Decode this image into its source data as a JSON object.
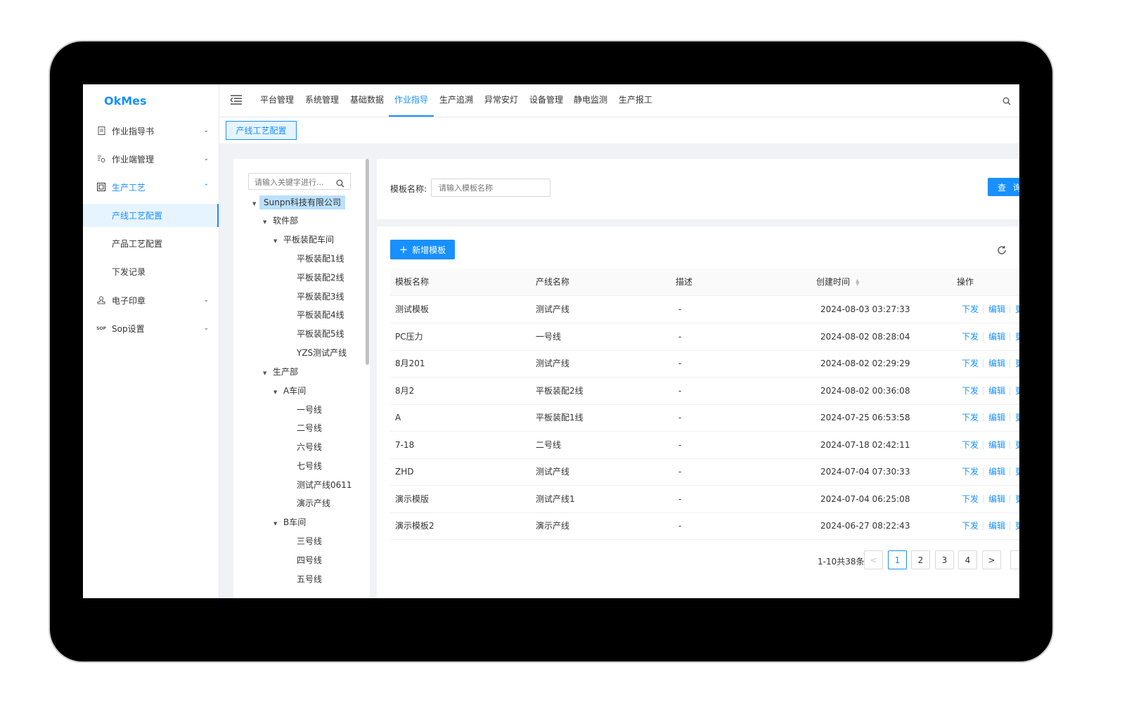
{
  "app": {
    "logo": "OkMes"
  },
  "sidebar": {
    "items": [
      {
        "label": "作业指导书",
        "icon": "document-icon"
      },
      {
        "label": "作业端管理",
        "icon": "terminal-icon"
      },
      {
        "label": "生产工艺",
        "icon": "process-icon"
      },
      {
        "label": "电子印章",
        "icon": "stamp-icon"
      },
      {
        "label": "Sop设置",
        "icon": "sop-icon",
        "icon_text": "SOP"
      }
    ],
    "subitems": [
      {
        "label": "产线工艺配置"
      },
      {
        "label": "产品工艺配置"
      },
      {
        "label": "下发记录"
      }
    ]
  },
  "topnav": {
    "items": [
      "平台管理",
      "系统管理",
      "基础数据",
      "作业指导",
      "生产追溯",
      "异常安灯",
      "设备管理",
      "静电监测",
      "生产报工"
    ],
    "active": "作业指导"
  },
  "tabs": [
    {
      "label": "产线工艺配置"
    }
  ],
  "tree": {
    "search_placeholder": "请输入关键字进行...",
    "nodes": [
      {
        "label": "Sunpn科技有限公司",
        "expanded": true,
        "selected": true
      },
      {
        "label": "软件部",
        "expanded": true
      },
      {
        "label": "平板装配车间",
        "expanded": true
      },
      {
        "label": "平板装配1线"
      },
      {
        "label": "平板装配2线"
      },
      {
        "label": "平板装配3线"
      },
      {
        "label": "平板装配4线"
      },
      {
        "label": "平板装配5线"
      },
      {
        "label": "YZS测试产线"
      },
      {
        "label": "生产部",
        "expanded": true
      },
      {
        "label": "A车间",
        "expanded": true
      },
      {
        "label": "一号线"
      },
      {
        "label": "二号线"
      },
      {
        "label": "六号线"
      },
      {
        "label": "七号线"
      },
      {
        "label": "测试产线0611"
      },
      {
        "label": "演示产线"
      },
      {
        "label": "B车间",
        "expanded": true
      },
      {
        "label": "三号线"
      },
      {
        "label": "四号线"
      },
      {
        "label": "五号线"
      }
    ]
  },
  "search": {
    "label": "模板名称:",
    "placeholder": "请输入模板名称",
    "button": "查 询"
  },
  "table": {
    "add_button": "新增模板",
    "columns": [
      "模板名称",
      "产线名称",
      "描述",
      "创建时间",
      "操作"
    ],
    "action_labels": [
      "下发",
      "编辑",
      "更"
    ],
    "rows": [
      {
        "name": "测试模板",
        "line": "测试产线",
        "desc": "-",
        "created": "2024-08-03 03:27:33"
      },
      {
        "name": "PC压力",
        "line": "一号线",
        "desc": "-",
        "created": "2024-08-02 08:28:04"
      },
      {
        "name": "8月201",
        "line": "测试产线",
        "desc": "-",
        "created": "2024-08-02 02:29:29"
      },
      {
        "name": "8月2",
        "line": "平板装配2线",
        "desc": "-",
        "created": "2024-08-02 00:36:08"
      },
      {
        "name": "A",
        "line": "平板装配1线",
        "desc": "-",
        "created": "2024-07-25 06:53:58"
      },
      {
        "name": "7-18",
        "line": "二号线",
        "desc": "-",
        "created": "2024-07-18 02:42:11"
      },
      {
        "name": "ZHD",
        "line": "测试产线",
        "desc": "-",
        "created": "2024-07-04 07:30:33"
      },
      {
        "name": "演示模版",
        "line": "测试产线1",
        "desc": "-",
        "created": "2024-07-04 06:25:08"
      },
      {
        "name": "演示模板2",
        "line": "演示产线",
        "desc": "-",
        "created": "2024-06-27 08:22:43"
      }
    ]
  },
  "pagination": {
    "total_text": "1-10共38条",
    "pages": [
      "1",
      "2",
      "3",
      "4"
    ],
    "current": "1",
    "prev": "<",
    "next": ">"
  },
  "colors": {
    "accent": "#1890ff",
    "selected_bg": "#e6f4ff",
    "bezel": "#000000"
  }
}
